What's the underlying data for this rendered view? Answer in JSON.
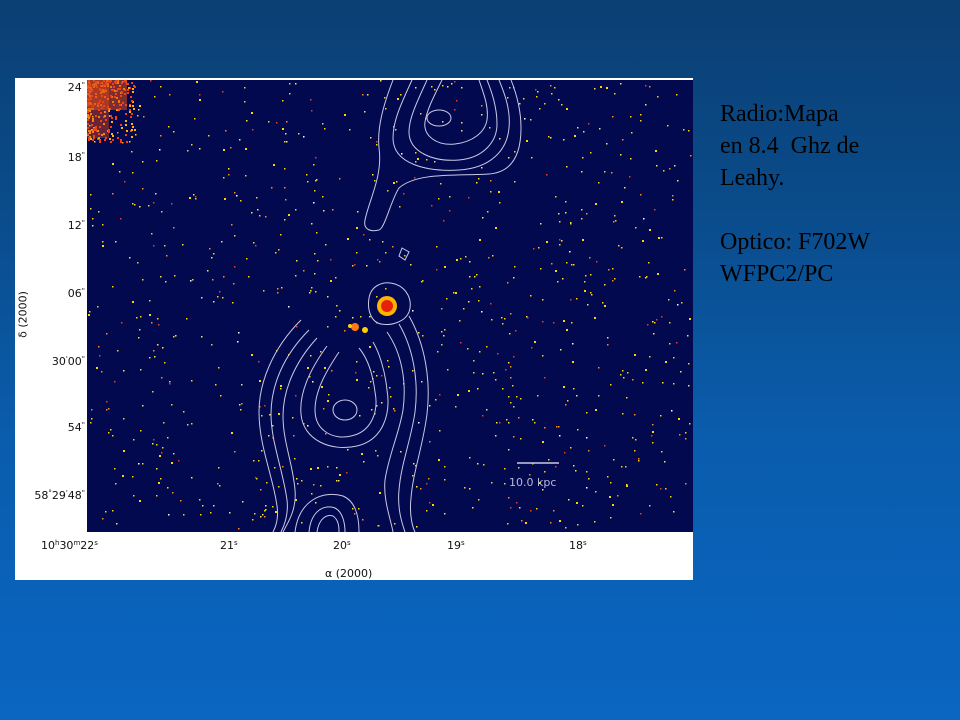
{
  "caption": {
    "radio_line1": "Radio:Mapa",
    "radio_line2": "en 8.4  Ghz de",
    "radio_line3": "Leahy.",
    "optical_line1": "Optico: F702W",
    "optical_line2": "WFPC2/PC"
  },
  "figure": {
    "y_axis_label": "δ (2000)",
    "x_axis_label": "α (2000)",
    "scale_bar_label": "10.0  kpc",
    "y_ticks": [
      "24",
      "18",
      "12",
      "06",
      "30",
      "54",
      "58 29 48"
    ],
    "x_ticks": [
      "10 30 22",
      "21",
      "20",
      "19",
      "18"
    ],
    "contour_color": "#c9c9e6",
    "background_color": "#03094e"
  }
}
